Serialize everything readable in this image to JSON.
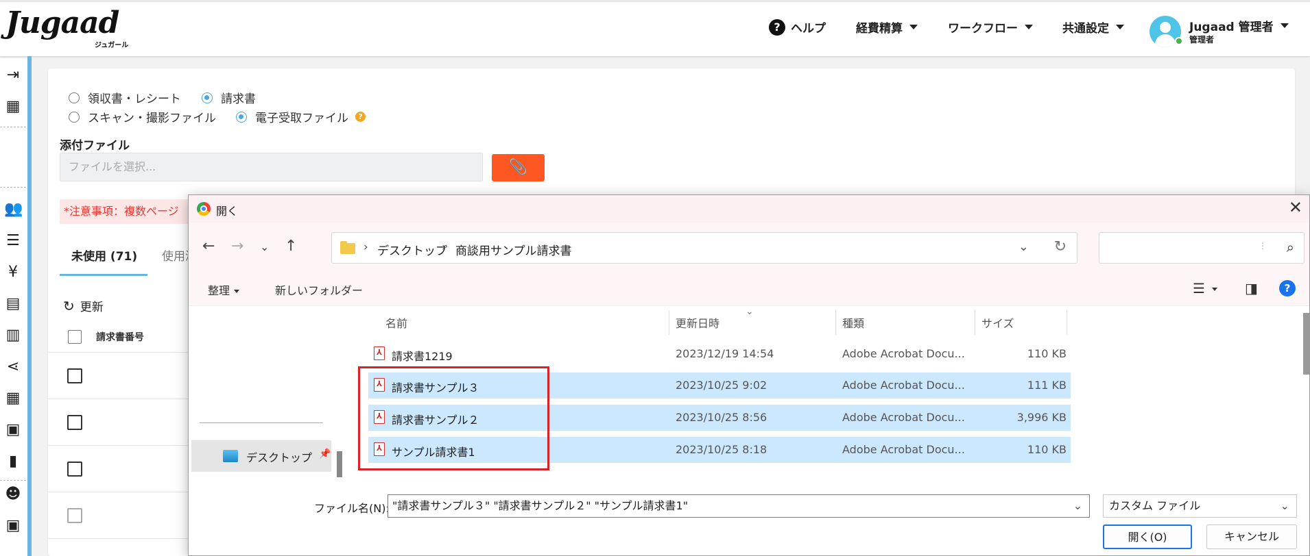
{
  "header": {
    "logo": "Jugaad",
    "logo_sub": "ジュガール",
    "help": "ヘルプ",
    "nav": [
      "経費精算",
      "ワークフロー",
      "共通設定"
    ],
    "user_name": "Jugaad 管理者",
    "user_role": "管理者"
  },
  "form": {
    "radio_receipt": "領収書・レシート",
    "radio_invoice": "請求書",
    "radio_scan": "スキャン・撮影ファイル",
    "radio_electronic": "電子受取ファイル",
    "attach_label": "添付ファイル",
    "file_placeholder": "ファイルを選択...",
    "notice": "*注意事項：複数ページ"
  },
  "tabs": {
    "unused": "未使用 (71)",
    "used": "使用済"
  },
  "list": {
    "refresh": "更新",
    "col_invoice_no": "請求書番号"
  },
  "dialog": {
    "title": "開く",
    "breadcrumb": [
      "デスクトップ",
      "商談用サンプル請求書"
    ],
    "organize": "整理",
    "new_folder": "新しいフォルダー",
    "nav_desktop": "デスクトップ",
    "columns": {
      "name": "名前",
      "date": "更新日時",
      "type": "種類",
      "size": "サイズ"
    },
    "files": [
      {
        "name": "請求書1219",
        "date": "2023/12/19 14:54",
        "type": "Adobe Acrobat Docu...",
        "size": "110 KB",
        "selected": false
      },
      {
        "name": "請求書サンプル３",
        "date": "2023/10/25 9:02",
        "type": "Adobe Acrobat Docu...",
        "size": "111 KB",
        "selected": true
      },
      {
        "name": "請求書サンプル２",
        "date": "2023/10/25 8:56",
        "type": "Adobe Acrobat Docu...",
        "size": "3,996 KB",
        "selected": true
      },
      {
        "name": "サンプル請求書1",
        "date": "2023/10/25 8:18",
        "type": "Adobe Acrobat Docu...",
        "size": "110 KB",
        "selected": true
      }
    ],
    "filename_label": "ファイル名(N):",
    "filename_value": "\"請求書サンプル３\" \"請求書サンプル２\" \"サンプル請求書1\"",
    "filetype": "カスタム ファイル",
    "open_button": "開く(O)",
    "cancel_button": "キャンセル"
  },
  "colors": {
    "accent": "#ff5722",
    "selection": "#cce8ff",
    "highlight_box": "#d9222a",
    "sidebar_edge": "#6ab4e2"
  }
}
